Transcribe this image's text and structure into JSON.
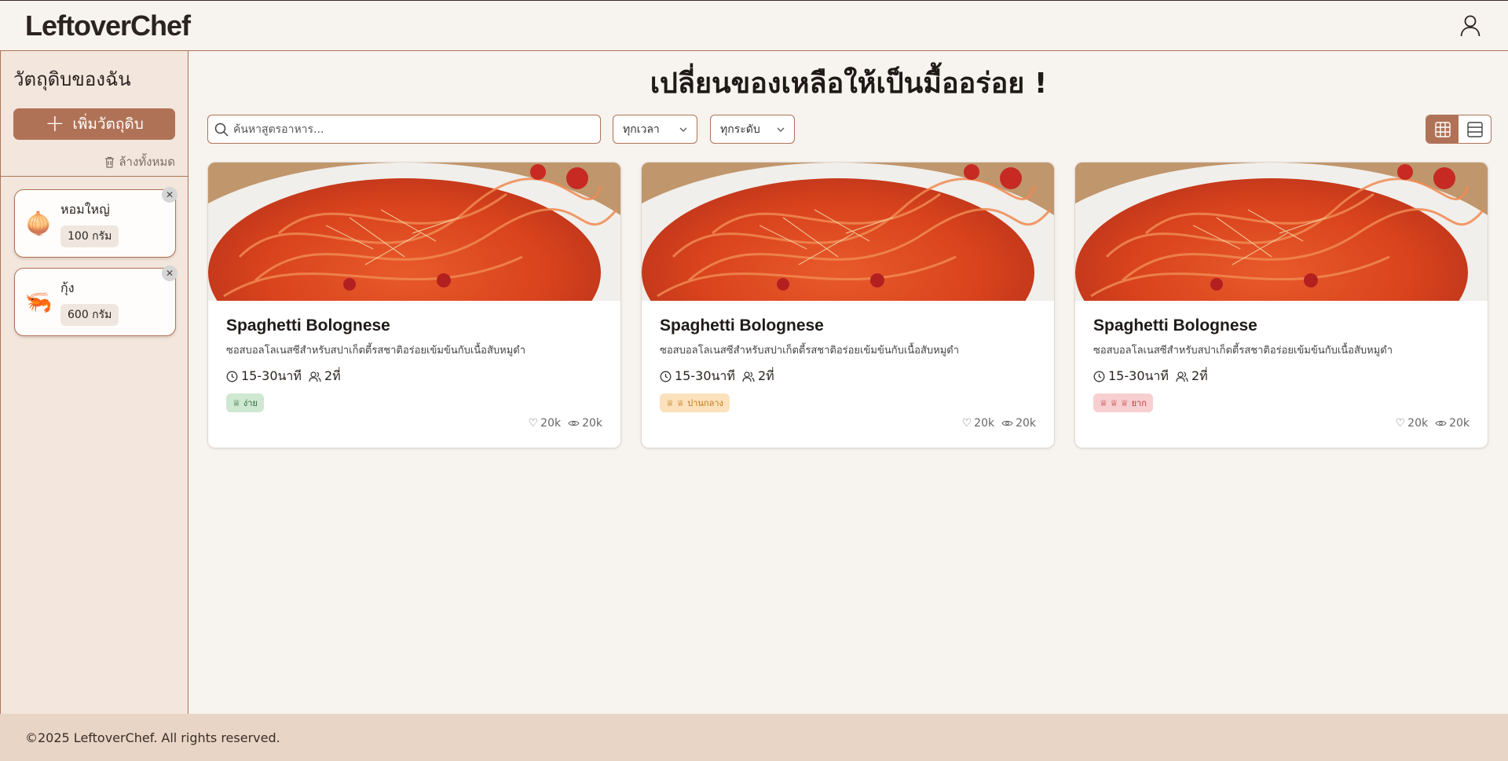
{
  "header": {
    "logo": "LeftoverChef"
  },
  "sidebar": {
    "title": "วัตถุดิบของฉัน",
    "add_button_label": "เพิ่มวัตถุดิบ",
    "clear_all_label": "ล้างทั้งหมด",
    "ingredients": [
      {
        "name": "หอมใหญ่",
        "quantity": "100 กรัม",
        "emoji": "🧅"
      },
      {
        "name": "กุ้ง",
        "quantity": "600 กรัม",
        "emoji": "🦐"
      }
    ]
  },
  "main": {
    "hero_title": "เปลี่ยนของเหลือให้เป็นมื้ออร่อย !",
    "search": {
      "placeholder": "ค้นหาสูตรอาหาร..."
    },
    "filters": {
      "time_value": "ทุกเวลา",
      "level_value": "ทุกระดับ"
    },
    "recipes": [
      {
        "title": "Spaghetti Bolognese",
        "description": "ซอสบอลโลเนสซีสำหรับสปาเก็ตตี้รสชาติอร่อยเข้มข้นกับเนื้อสับหมูดำ",
        "time": "15-30นาที",
        "servings": "2ที่",
        "difficulty": "ง่าย",
        "likes": "20k",
        "views": "20k"
      },
      {
        "title": "Spaghetti Bolognese",
        "description": "ซอสบอลโลเนสซีสำหรับสปาเก็ตตี้รสชาติอร่อยเข้มข้นกับเนื้อสับหมูดำ",
        "time": "15-30นาที",
        "servings": "2ที่",
        "difficulty": "ปานกลาง",
        "likes": "20k",
        "views": "20k"
      },
      {
        "title": "Spaghetti Bolognese",
        "description": "ซอสบอลโลเนสซีสำหรับสปาเก็ตตี้รสชาติอร่อยเข้มข้นกับเนื้อสับหมูดำ",
        "time": "15-30นาที",
        "servings": "2ที่",
        "difficulty": "ยาก",
        "likes": "20k",
        "views": "20k"
      }
    ]
  },
  "footer": {
    "copyright": "©2025 LeftoverChef. All rights reserved."
  },
  "colors": {
    "accent": "#b07256",
    "background": "#f7f3ee",
    "sidebar_bg": "#f2e6dd",
    "footer_bg": "#e8d5c6"
  }
}
